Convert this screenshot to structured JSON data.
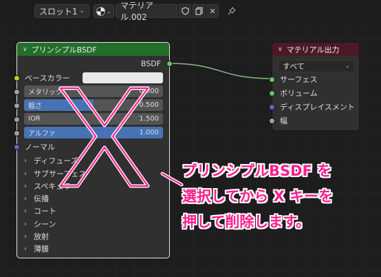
{
  "header": {
    "slot_label": "スロット1",
    "material_name": "マテリアル.002",
    "close_glyph": "✕"
  },
  "bsdf_node": {
    "title": "プリンシプルBSDF",
    "output_label": "BSDF",
    "base_color_label": "ベースカラー",
    "fields": [
      {
        "label": "メタリック",
        "value": "0.000",
        "fill": 0.0
      },
      {
        "label": "粗さ",
        "value": "0.500",
        "fill": 0.5
      },
      {
        "label": "IOR",
        "value": "1.500",
        "fill": 0.0
      },
      {
        "label": "アルファ",
        "value": "1.000",
        "fill": 1.0
      }
    ],
    "normal_label": "ノーマル",
    "panels": [
      "ディフューズ",
      "サブサーフェス",
      "スペキュラー",
      "伝播",
      "コート",
      "シーン",
      "放射",
      "薄膜"
    ]
  },
  "output_node": {
    "title": "マテリアル出力",
    "target_value": "すべて",
    "inputs": [
      "サーフェス",
      "ボリューム",
      "ディスプレイスメント",
      "幅"
    ]
  },
  "annotation": {
    "lines": [
      "プリンシプルBSDF を",
      "選択してから X キーを",
      "押して削除します。"
    ]
  },
  "colors": {
    "annotation": "#ff1e8c",
    "bsdf_header": "#246d2a",
    "output_header": "#4c1a26",
    "link": "#8fb58c"
  }
}
